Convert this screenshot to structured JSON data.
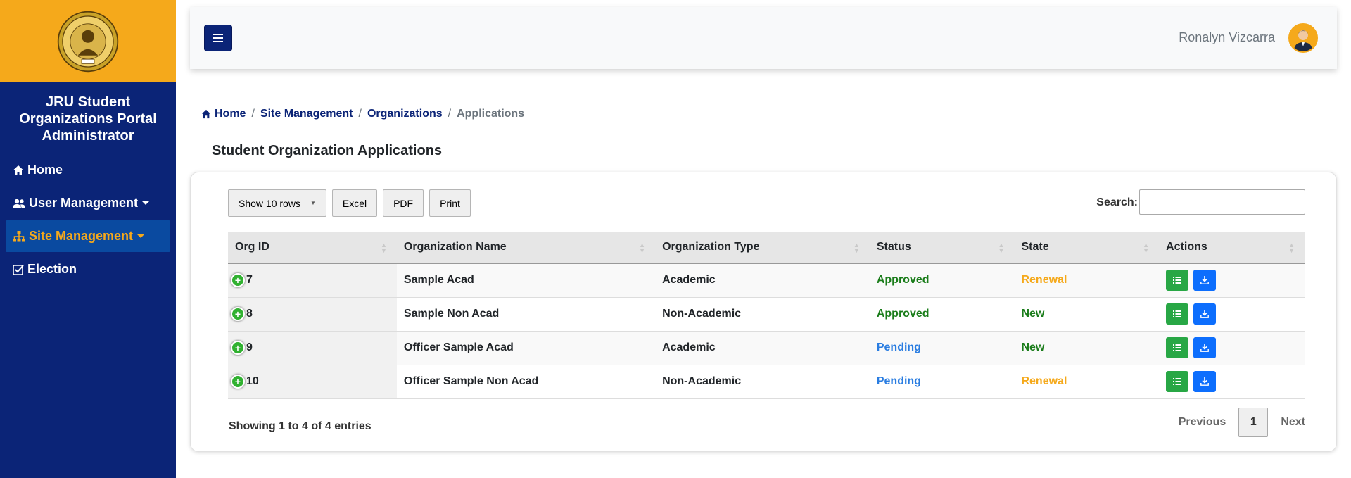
{
  "sidebar": {
    "brand": "JRU Student Organizations Portal Administrator",
    "items": [
      {
        "label": "Home"
      },
      {
        "label": "User Management"
      },
      {
        "label": "Site Management"
      },
      {
        "label": "Election"
      }
    ]
  },
  "header": {
    "username": "Ronalyn Vizcarra"
  },
  "breadcrumb": {
    "items": [
      "Home",
      "Site Management",
      "Organizations"
    ],
    "current": "Applications",
    "separator": "/"
  },
  "page": {
    "title": "Student Organization Applications"
  },
  "toolbar": {
    "show_rows": "Show 10 rows",
    "excel": "Excel",
    "pdf": "PDF",
    "print": "Print",
    "search_label": "Search:",
    "search_value": ""
  },
  "table": {
    "columns": [
      "Org ID",
      "Organization Name",
      "Organization Type",
      "Status",
      "State",
      "Actions"
    ],
    "rows": [
      {
        "id": "7",
        "name": "Sample Acad",
        "type": "Academic",
        "status": "Approved",
        "state": "Renewal"
      },
      {
        "id": "8",
        "name": "Sample Non Acad",
        "type": "Non-Academic",
        "status": "Approved",
        "state": "New"
      },
      {
        "id": "9",
        "name": "Officer Sample Acad",
        "type": "Academic",
        "status": "Pending",
        "state": "New"
      },
      {
        "id": "10",
        "name": "Officer Sample Non Acad",
        "type": "Non-Academic",
        "status": "Pending",
        "state": "Renewal"
      }
    ]
  },
  "footer": {
    "info": "Showing 1 to 4 of 4 entries",
    "previous": "Previous",
    "current_page": "1",
    "next": "Next"
  },
  "colors": {
    "sidebar": "#0b2477",
    "accent": "#f5a91b",
    "approved": "#1b7d1b",
    "pending": "#2a7de1"
  }
}
